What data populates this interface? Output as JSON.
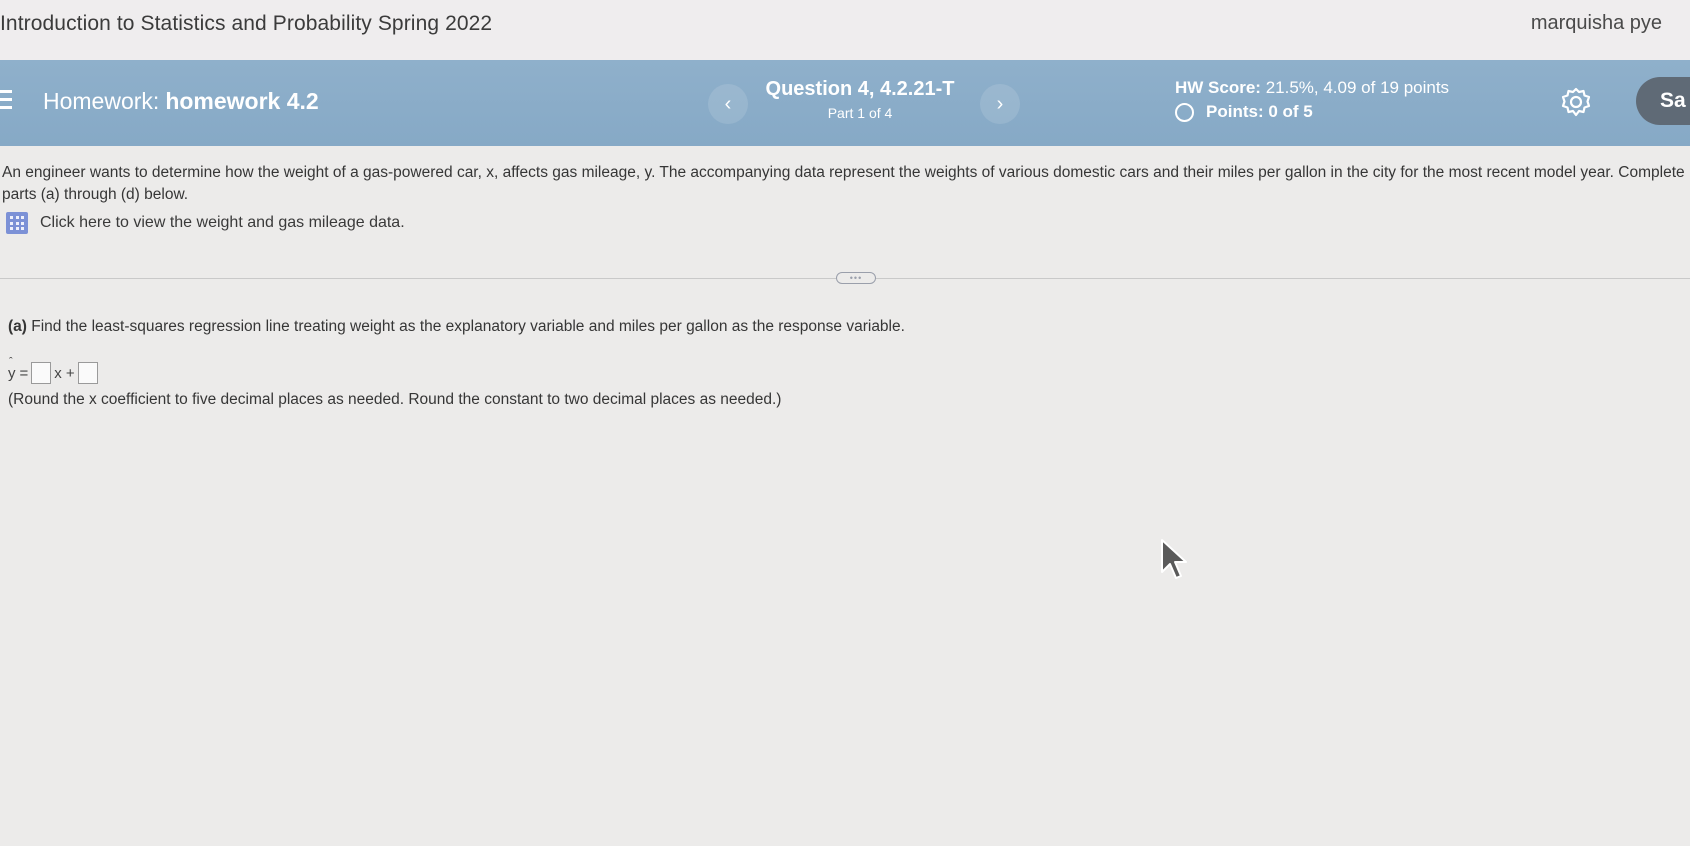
{
  "topbar": {
    "course_title": "Introduction to Statistics and Probability Spring 2022",
    "user_name": "marquisha pye"
  },
  "hwbar": {
    "homework_label": "Homework:",
    "homework_name": "homework 4.2",
    "prev_icon": "‹",
    "next_icon": "›",
    "question_title": "Question 4, 4.2.21-T",
    "question_part": "Part 1 of 4",
    "hw_score_label": "HW Score:",
    "hw_score_value": "21.5%, 4.09 of 19 points",
    "points_text": "Points: 0 of 5",
    "save_label": "Sa"
  },
  "problem": {
    "text": "An engineer wants to determine how the weight of a gas-powered car, x, affects gas mileage, y. The accompanying data represent the weights of various domestic cars and their miles per gallon in the city for the most recent model year. Complete parts (a) through (d) below.",
    "data_link_label": "Click here to view the weight and gas mileage data."
  },
  "divider": {
    "handle_text": "•••"
  },
  "part_a": {
    "label": "(a)",
    "question": "Find the least-squares regression line treating weight as the explanatory variable and miles per gallon as the response variable.",
    "y_symbol": "y",
    "hat_symbol": "ˆ",
    "equals": "=",
    "x_plus": "x +",
    "round_note": "(Round the x coefficient to five decimal places as needed. Round the constant to two decimal places as needed.)"
  },
  "colors": {
    "hwbar": "#8fb0cb",
    "save_button": "#5f6a76",
    "grid_icon": "#7c91d6"
  },
  "icons": {
    "menu": "menu-icon",
    "gear": "gear-icon",
    "grid": "grid-icon",
    "cursor": "cursor-icon"
  }
}
